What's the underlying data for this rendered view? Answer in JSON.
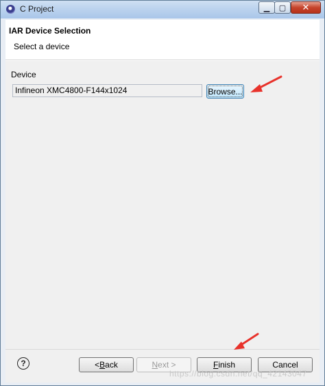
{
  "window": {
    "title": "C Project"
  },
  "title_controls": {
    "minimize": "▁",
    "maximize": "▢",
    "close": "✕"
  },
  "header": {
    "title": "IAR Device Selection",
    "subtitle": "Select a device"
  },
  "device": {
    "label": "Device",
    "value": "Infineon XMC4800-F144x1024",
    "browse_label": "Browse..."
  },
  "footer": {
    "help": "?",
    "back_prefix": "< ",
    "back_key": "B",
    "back_rest": "ack",
    "next_key": "N",
    "next_rest": "ext >",
    "finish_key": "F",
    "finish_rest": "inish",
    "cancel_label": "Cancel"
  },
  "watermark": "https://blog.csdn.net/qq_42143047",
  "colors": {
    "annotation_arrow": "#e8322b",
    "button_focus": "#3c7fb1"
  }
}
